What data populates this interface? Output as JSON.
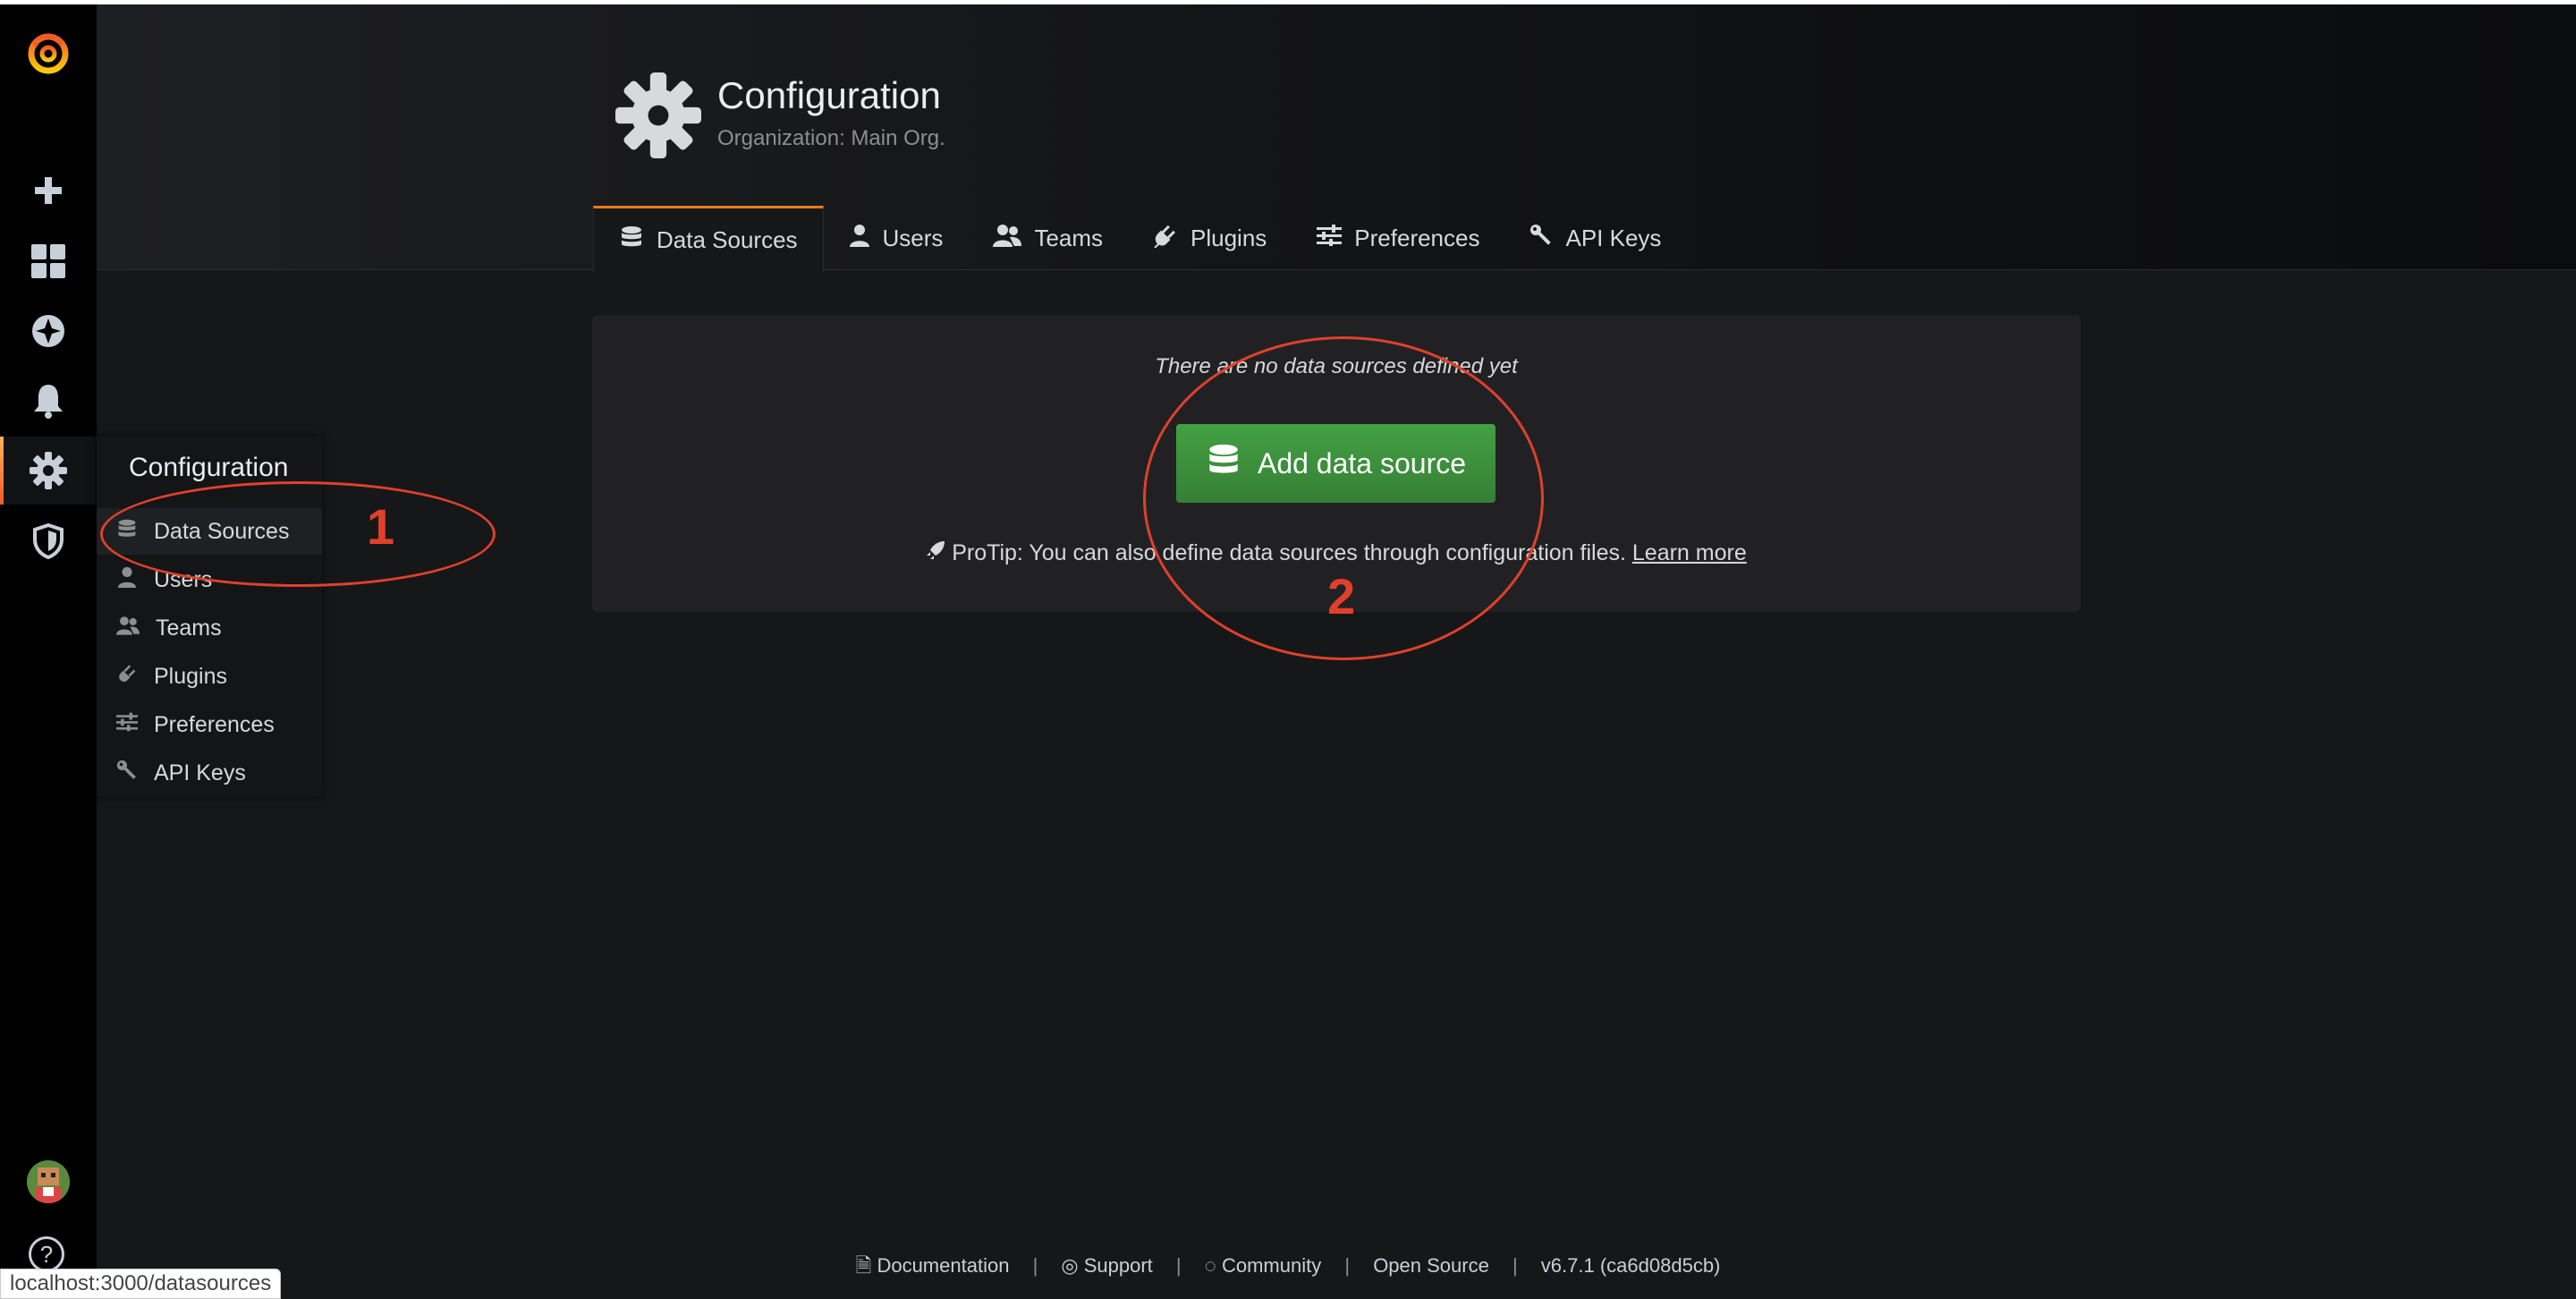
{
  "header": {
    "title": "Configuration",
    "subtitle": "Organization: Main Org."
  },
  "tabs": [
    {
      "label": "Data Sources",
      "icon": "database-icon",
      "active": true
    },
    {
      "label": "Users",
      "icon": "user-icon"
    },
    {
      "label": "Teams",
      "icon": "users-icon"
    },
    {
      "label": "Plugins",
      "icon": "plug-icon"
    },
    {
      "label": "Preferences",
      "icon": "sliders-icon"
    },
    {
      "label": "API Keys",
      "icon": "key-icon"
    }
  ],
  "main": {
    "empty_message": "There are no data sources defined yet",
    "add_button": "Add data source",
    "protip_text": "ProTip: You can also define data sources through configuration files.",
    "protip_link": "Learn more"
  },
  "flyout": {
    "title": "Configuration",
    "items": [
      {
        "label": "Data Sources",
        "icon": "database-icon",
        "active": true
      },
      {
        "label": "Users",
        "icon": "user-icon"
      },
      {
        "label": "Teams",
        "icon": "users-icon"
      },
      {
        "label": "Plugins",
        "icon": "plug-icon"
      },
      {
        "label": "Preferences",
        "icon": "sliders-icon"
      },
      {
        "label": "API Keys",
        "icon": "key-icon"
      }
    ]
  },
  "sidemenu": {
    "icons": [
      "grafana-logo-icon",
      "plus-icon",
      "dashboards-icon",
      "explore-icon",
      "bell-icon",
      "gear-icon",
      "shield-icon"
    ]
  },
  "annotations": {
    "one": "1",
    "two": "2"
  },
  "footer": {
    "documentation": "Documentation",
    "support": "Support",
    "community": "Community",
    "open_source": "Open Source",
    "version": "v6.7.1 (ca6d08d5cb)",
    "separator": "|"
  },
  "status_url": "localhost:3000/datasources",
  "colors": {
    "accent_orange": "#eb7b18",
    "button_green": "#3d8f3d",
    "annotation_red": "#e0402b",
    "background": "#161719"
  }
}
